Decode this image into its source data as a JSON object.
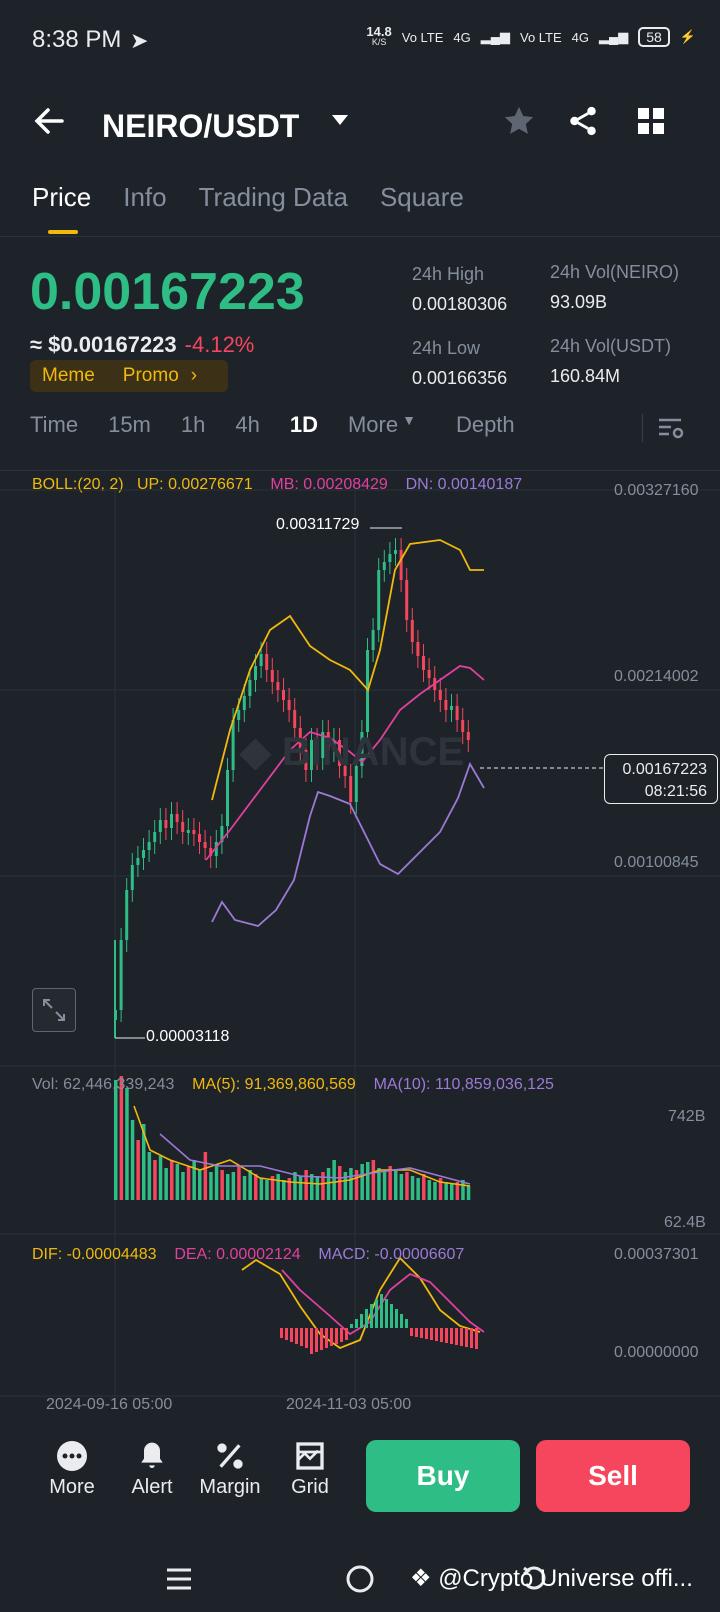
{
  "status_bar": {
    "time": "8:38 PM",
    "net_speed": "14.8",
    "net_unit": "K/S",
    "sig1": "Vo LTE",
    "sig2": "4G",
    "sig3": "Vo LTE",
    "sig4": "4G",
    "battery": "58"
  },
  "header": {
    "pair": "NEIRO/USDT"
  },
  "tabs": [
    "Price",
    "Info",
    "Trading Data",
    "Square"
  ],
  "ticker": {
    "last_price": "0.00167223",
    "approx": "≈ $0.00167223",
    "change": "-4.12%",
    "tag1": "Meme",
    "tag2": "Promo",
    "high_label": "24h High",
    "high": "0.00180306",
    "low_label": "24h Low",
    "low": "0.00166356",
    "vol_base_label": "24h Vol(NEIRO)",
    "vol_base": "93.09B",
    "vol_quote_label": "24h Vol(USDT)",
    "vol_quote": "160.84M"
  },
  "intervals": [
    "Time",
    "15m",
    "1h",
    "4h",
    "1D",
    "More",
    "Depth"
  ],
  "boll": {
    "label": "BOLL:(20, 2)",
    "up": "UP: 0.00276671",
    "mb": "MB: 0.00208429",
    "dn": "DN: 0.00140187"
  },
  "price_axis": [
    "0.00327160",
    "0.00214002",
    "0.00100845"
  ],
  "annotations": {
    "high": "0.00311729",
    "low": "0.00003118"
  },
  "current_tag": {
    "price": "0.00167223",
    "countdown": "08:21:56"
  },
  "volume": {
    "vol": "Vol: 62,446,339,243",
    "ma5": "MA(5): 91,369,860,569",
    "ma10": "MA(10): 110,859,036,125",
    "axis_top": "742B",
    "axis_bottom": "62.4B"
  },
  "macd": {
    "dif": "DIF: -0.00004483",
    "dea": "DEA: 0.00002124",
    "macd": "MACD: -0.00006607",
    "axis_top": "0.00037301",
    "axis_zero": "0.00000000"
  },
  "dates": [
    "2024-09-16 05:00",
    "2024-11-03 05:00"
  ],
  "toolbar": {
    "more": "More",
    "alert": "Alert",
    "margin": "Margin",
    "grid": "Grid",
    "buy": "Buy",
    "sell": "Sell"
  },
  "watermark": "@Crypto Universe offi...",
  "colors": {
    "up": "#2ebd85",
    "down": "#f6465d",
    "accent": "#f0b90b",
    "ma_mid": "#e040a0",
    "ma_dn": "#9c7ad6"
  }
}
